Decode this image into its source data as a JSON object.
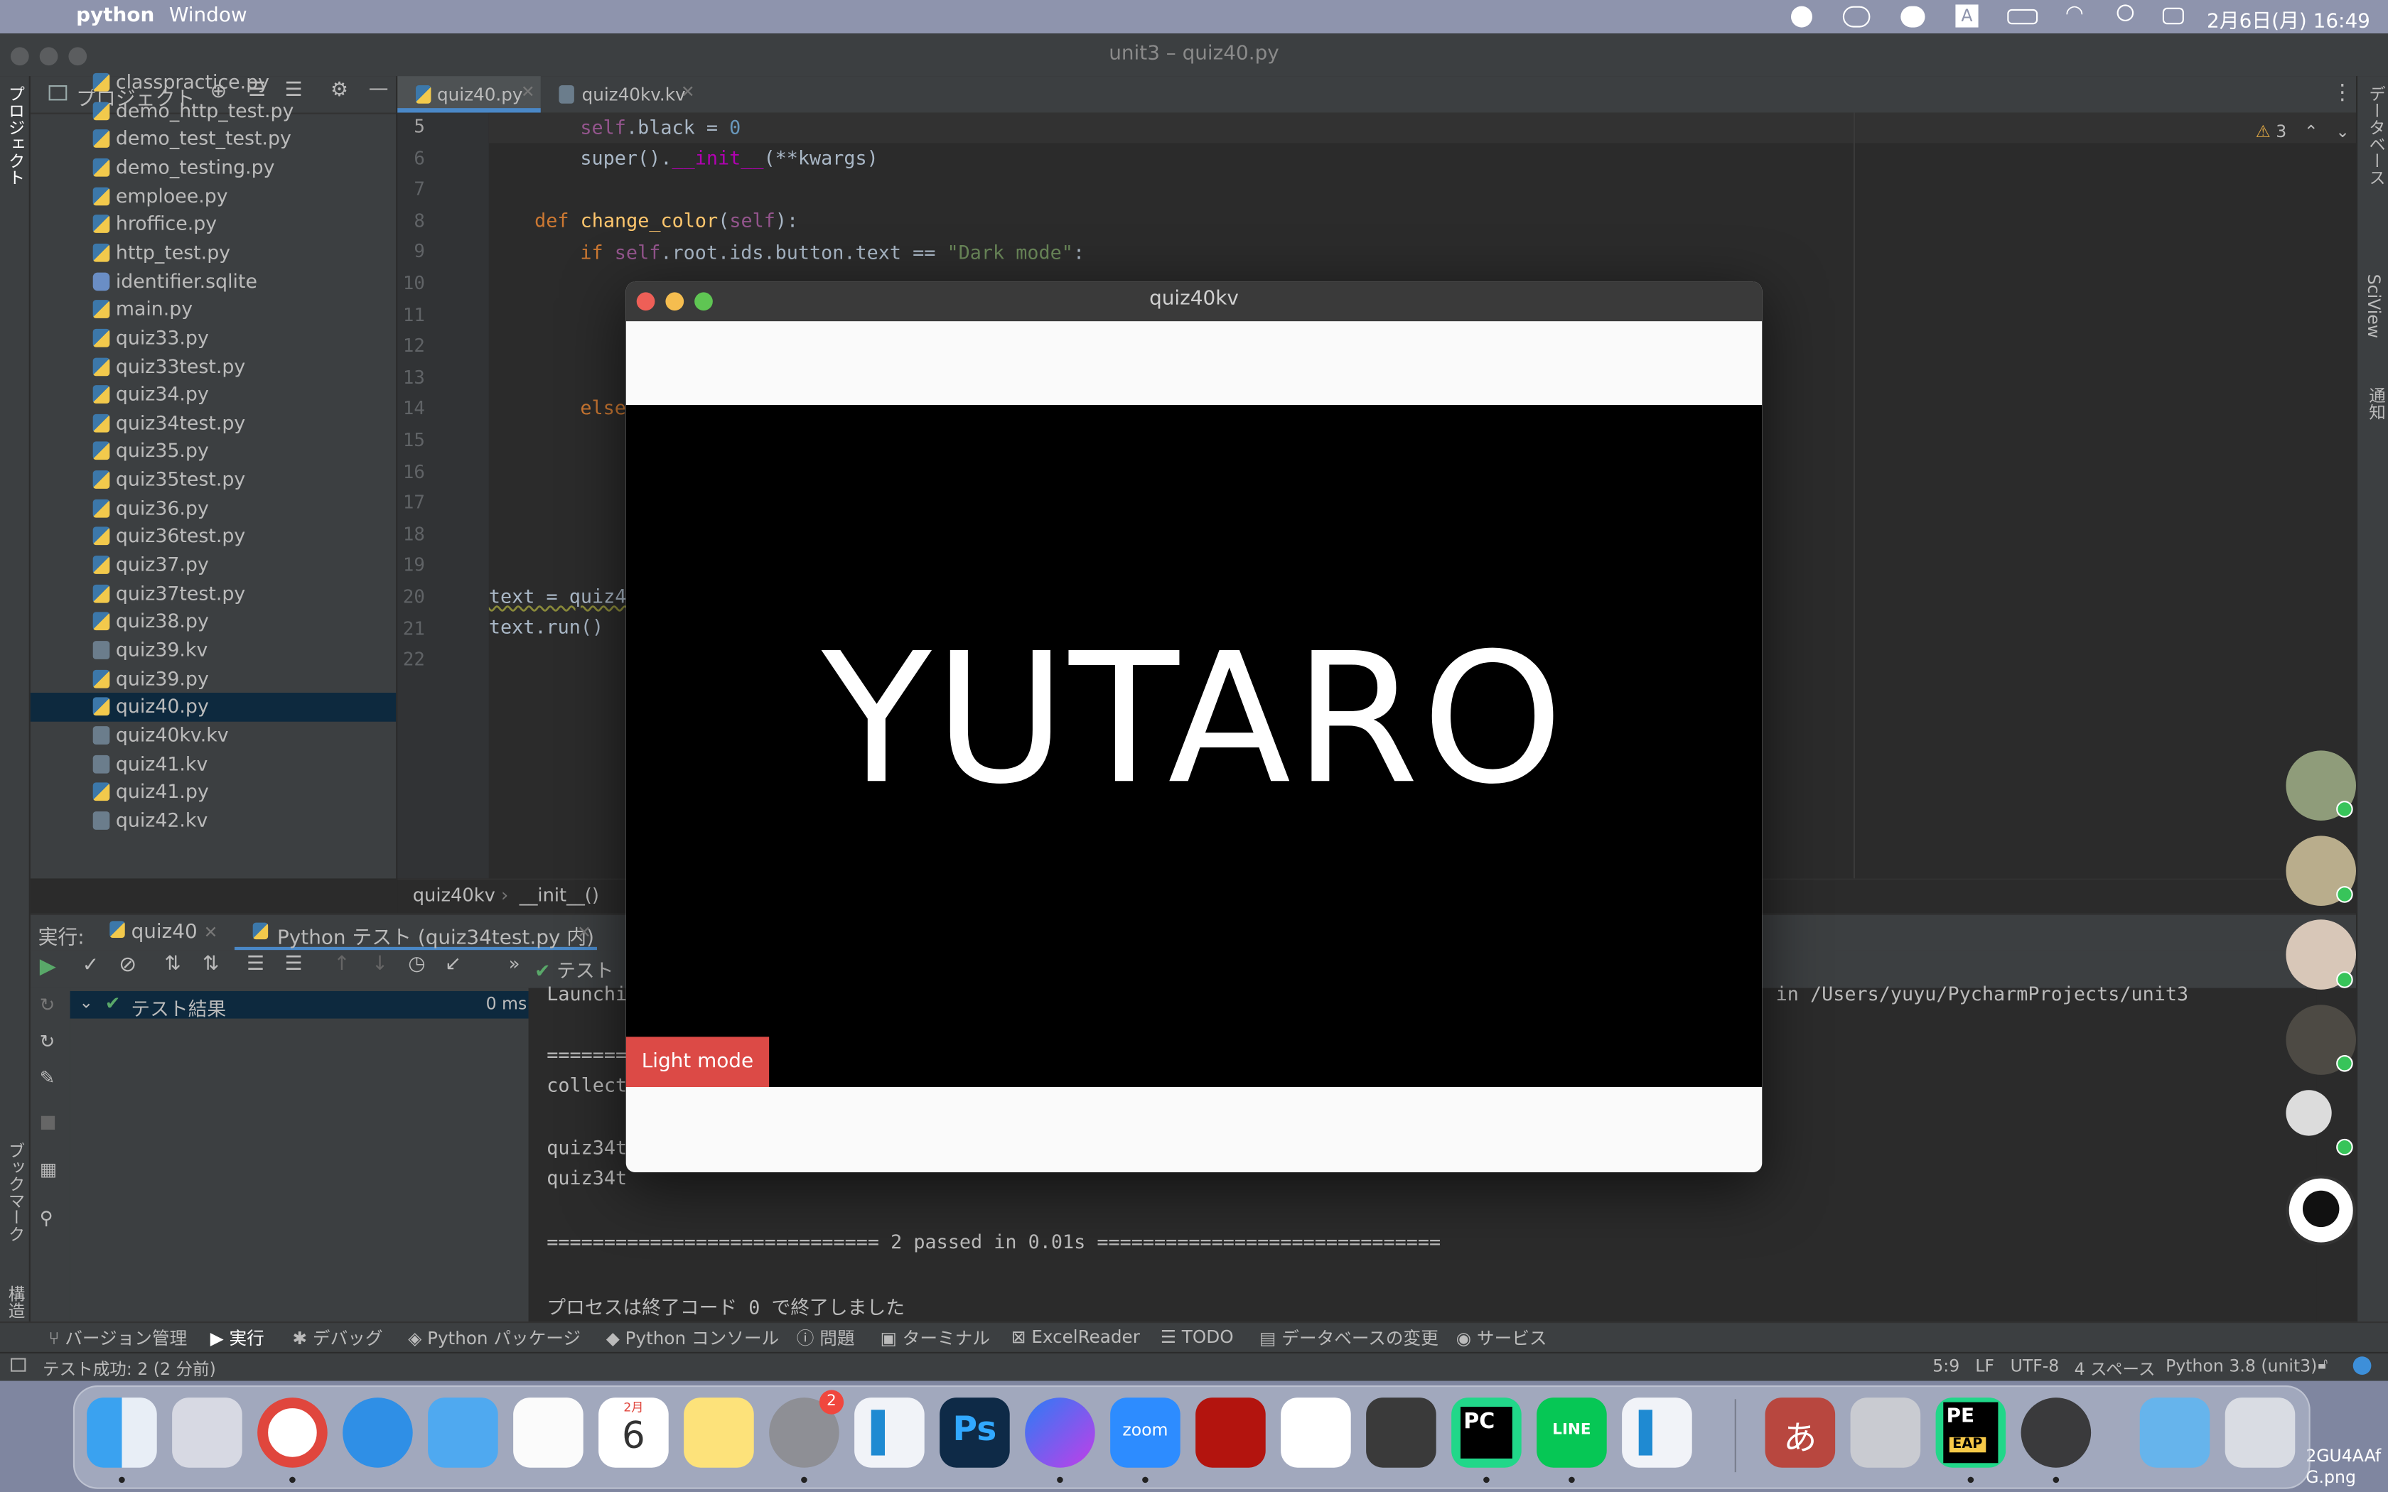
{
  "menubar": {
    "app": "python",
    "menu_window": "Window",
    "datetime": "2月6日(月) 16:49"
  },
  "ide": {
    "window_title": "unit3 – quiz40.py",
    "left_strip_project": "プロジェクト",
    "left_strip_bookmarks": "ブックマーク",
    "left_strip_structure": "構造",
    "right_strip_db": "データベース",
    "right_strip_sciview": "SciView",
    "right_strip_notify": "通知",
    "project_panel_title": "プロジェクト",
    "project_files": [
      {
        "name": "classpractice.py",
        "type": "py"
      },
      {
        "name": "demo_http_test.py",
        "type": "py"
      },
      {
        "name": "demo_test_test.py",
        "type": "py"
      },
      {
        "name": "demo_testing.py",
        "type": "py"
      },
      {
        "name": "emploee.py",
        "type": "py"
      },
      {
        "name": "hroffice.py",
        "type": "py"
      },
      {
        "name": "http_test.py",
        "type": "py"
      },
      {
        "name": "identifier.sqlite",
        "type": "db"
      },
      {
        "name": "main.py",
        "type": "py"
      },
      {
        "name": "quiz33.py",
        "type": "py"
      },
      {
        "name": "quiz33test.py",
        "type": "py"
      },
      {
        "name": "quiz34.py",
        "type": "py"
      },
      {
        "name": "quiz34test.py",
        "type": "py"
      },
      {
        "name": "quiz35.py",
        "type": "py"
      },
      {
        "name": "quiz35test.py",
        "type": "py"
      },
      {
        "name": "quiz36.py",
        "type": "py"
      },
      {
        "name": "quiz36test.py",
        "type": "py"
      },
      {
        "name": "quiz37.py",
        "type": "py"
      },
      {
        "name": "quiz37test.py",
        "type": "py"
      },
      {
        "name": "quiz38.py",
        "type": "py"
      },
      {
        "name": "quiz39.kv",
        "type": "kv"
      },
      {
        "name": "quiz39.py",
        "type": "py"
      },
      {
        "name": "quiz40.py",
        "type": "py",
        "selected": true
      },
      {
        "name": "quiz40kv.kv",
        "type": "kv"
      },
      {
        "name": "quiz41.kv",
        "type": "kv"
      },
      {
        "name": "quiz41.py",
        "type": "py"
      },
      {
        "name": "quiz42.kv",
        "type": "kv"
      }
    ],
    "tabs": [
      {
        "label": "quiz40.py",
        "active": true
      },
      {
        "label": "quiz40kv.kv",
        "active": false
      }
    ],
    "warning_count": "3",
    "line_numbers": [
      "5",
      "6",
      "7",
      "8",
      "9",
      "10",
      "11",
      "12",
      "13",
      "14",
      "15",
      "16",
      "17",
      "18",
      "19",
      "20",
      "21",
      "22"
    ],
    "code": {
      "l5_self": "self",
      "l5_rest": ".black = ",
      "l5_num": "0",
      "l6_a": "super().",
      "l6_b": "__init__",
      "l6_c": "(**kwargs)",
      "l8_def": "def ",
      "l8_fn": "change_color",
      "l8_open": "(",
      "l8_self": "self",
      "l8_close": "):",
      "l9_if": "if ",
      "l9_self": "self",
      "l9_mid": ".root.ids.button.text == ",
      "l9_str": "\"Dark mode\"",
      "l9_end": ":",
      "l14_else": "else",
      "l20": "text = quiz4",
      "l21": "text.run()"
    },
    "breadcrumb": [
      "quiz40kv",
      "__init__()"
    ],
    "run": {
      "label": "実行:",
      "tab1": "quiz40",
      "tab2": "Python テスト (quiz34test.py 内)",
      "tree_root": "テスト結果",
      "tree_time": "0 ms",
      "toolbar_more": "テスト",
      "console": {
        "launch": "Launchi",
        "launch_tail": "in /Users/yuyu/PycharmProjects/unit3",
        "sep": "=======",
        "collect": "collect",
        "q1": "quiz34t",
        "q2": "quiz34t",
        "passed": "============================= 2 passed in 0.01s ==============================",
        "exit": "プロセスは終了コード 0 で終了しました"
      }
    },
    "bottom_tools": [
      "バージョン管理",
      "実行",
      "デバッグ",
      "Python パッケージ",
      "Python コンソール",
      "問題",
      "ターミナル",
      "ExcelReader",
      "TODO",
      "データベースの変更",
      "サービス"
    ],
    "status": {
      "left": "テスト成功: 2 (2 分前)",
      "pos": "5:9",
      "eol": "LF",
      "enc": "UTF-8",
      "indent": "4 スペース",
      "interp": "Python 3.8 (unit3)"
    }
  },
  "kivy": {
    "title": "quiz40kv",
    "big_label": "YUTARO",
    "button": "Light mode"
  },
  "dock": {
    "calendar_month": "2月",
    "calendar_day": "6",
    "settings_badge": "2",
    "zoom": "zoom",
    "line": "LINE",
    "pc": "PC",
    "pe": "PE",
    "eap": "EAP",
    "ps": "Ps",
    "kana": "あ",
    "file_label_1": "2GU4AAf",
    "file_label_2": "G.png"
  }
}
